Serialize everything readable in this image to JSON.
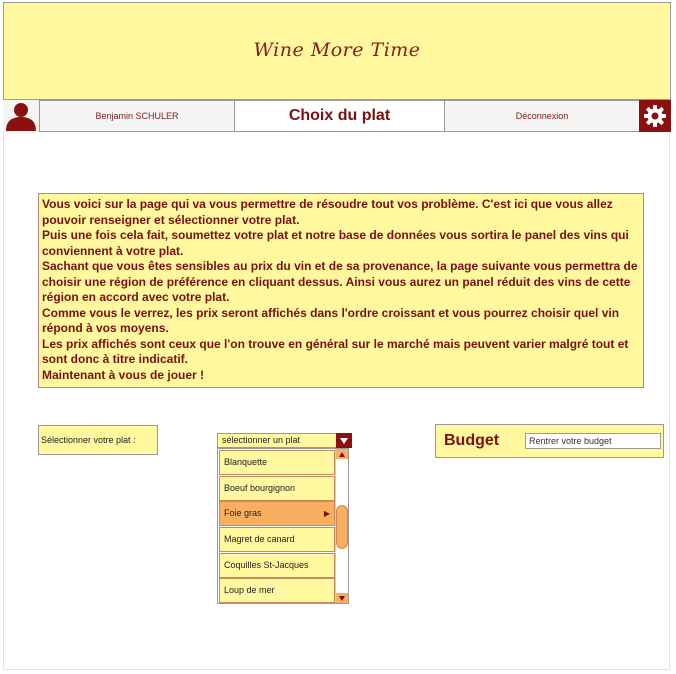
{
  "app": {
    "title": "Wine More Time"
  },
  "nav": {
    "user_name": "Benjamin SCHULER",
    "page_title": "Choix du plat",
    "logout_label": "Déconnexion",
    "user_icon": "user-icon",
    "settings_icon": "gear-icon"
  },
  "intro": {
    "paragraphs": [
      "Vous voici sur la page qui va vous permettre de résoudre tout vos problème. C'est ici que vous allez pouvoir renseigner et sélectionner votre plat.",
      "Puis une fois cela fait, soumettez votre plat et notre base de données vous sortira le panel des vins qui conviennent à votre plat.",
      "Sachant que vous êtes sensibles au prix du vin et de sa provenance, la page suivante vous permettra de choisir une région de préférence en cliquant dessus. Ainsi vous aurez un panel réduit des vins de cette région en accord avec votre plat.",
      "Comme vous le verrez, les prix seront affichés dans l'ordre croissant et vous pourrez choisir quel vin répond à vos moyens.",
      "Les prix affichés sont ceux que l'on trouve en général sur le marché mais peuvent varier malgré tout et sont donc à titre indicatif.",
      "Maintenant à vous de jouer !"
    ]
  },
  "dish_select": {
    "label": "Sélectionner votre plat :",
    "placeholder": "sélectionner un plat",
    "options": [
      "Blanquette",
      "Boeuf bourgignon",
      "Foie gras",
      "Magret de canard",
      "Coquilles St-Jacques",
      "Loup de mer"
    ],
    "highlighted": "Foie gras"
  },
  "budget": {
    "label": "Budget",
    "placeholder": "Rentrer votre budget"
  },
  "colors": {
    "accent": "#8b1010",
    "panel": "#fff89f",
    "highlight": "#f8b060"
  }
}
